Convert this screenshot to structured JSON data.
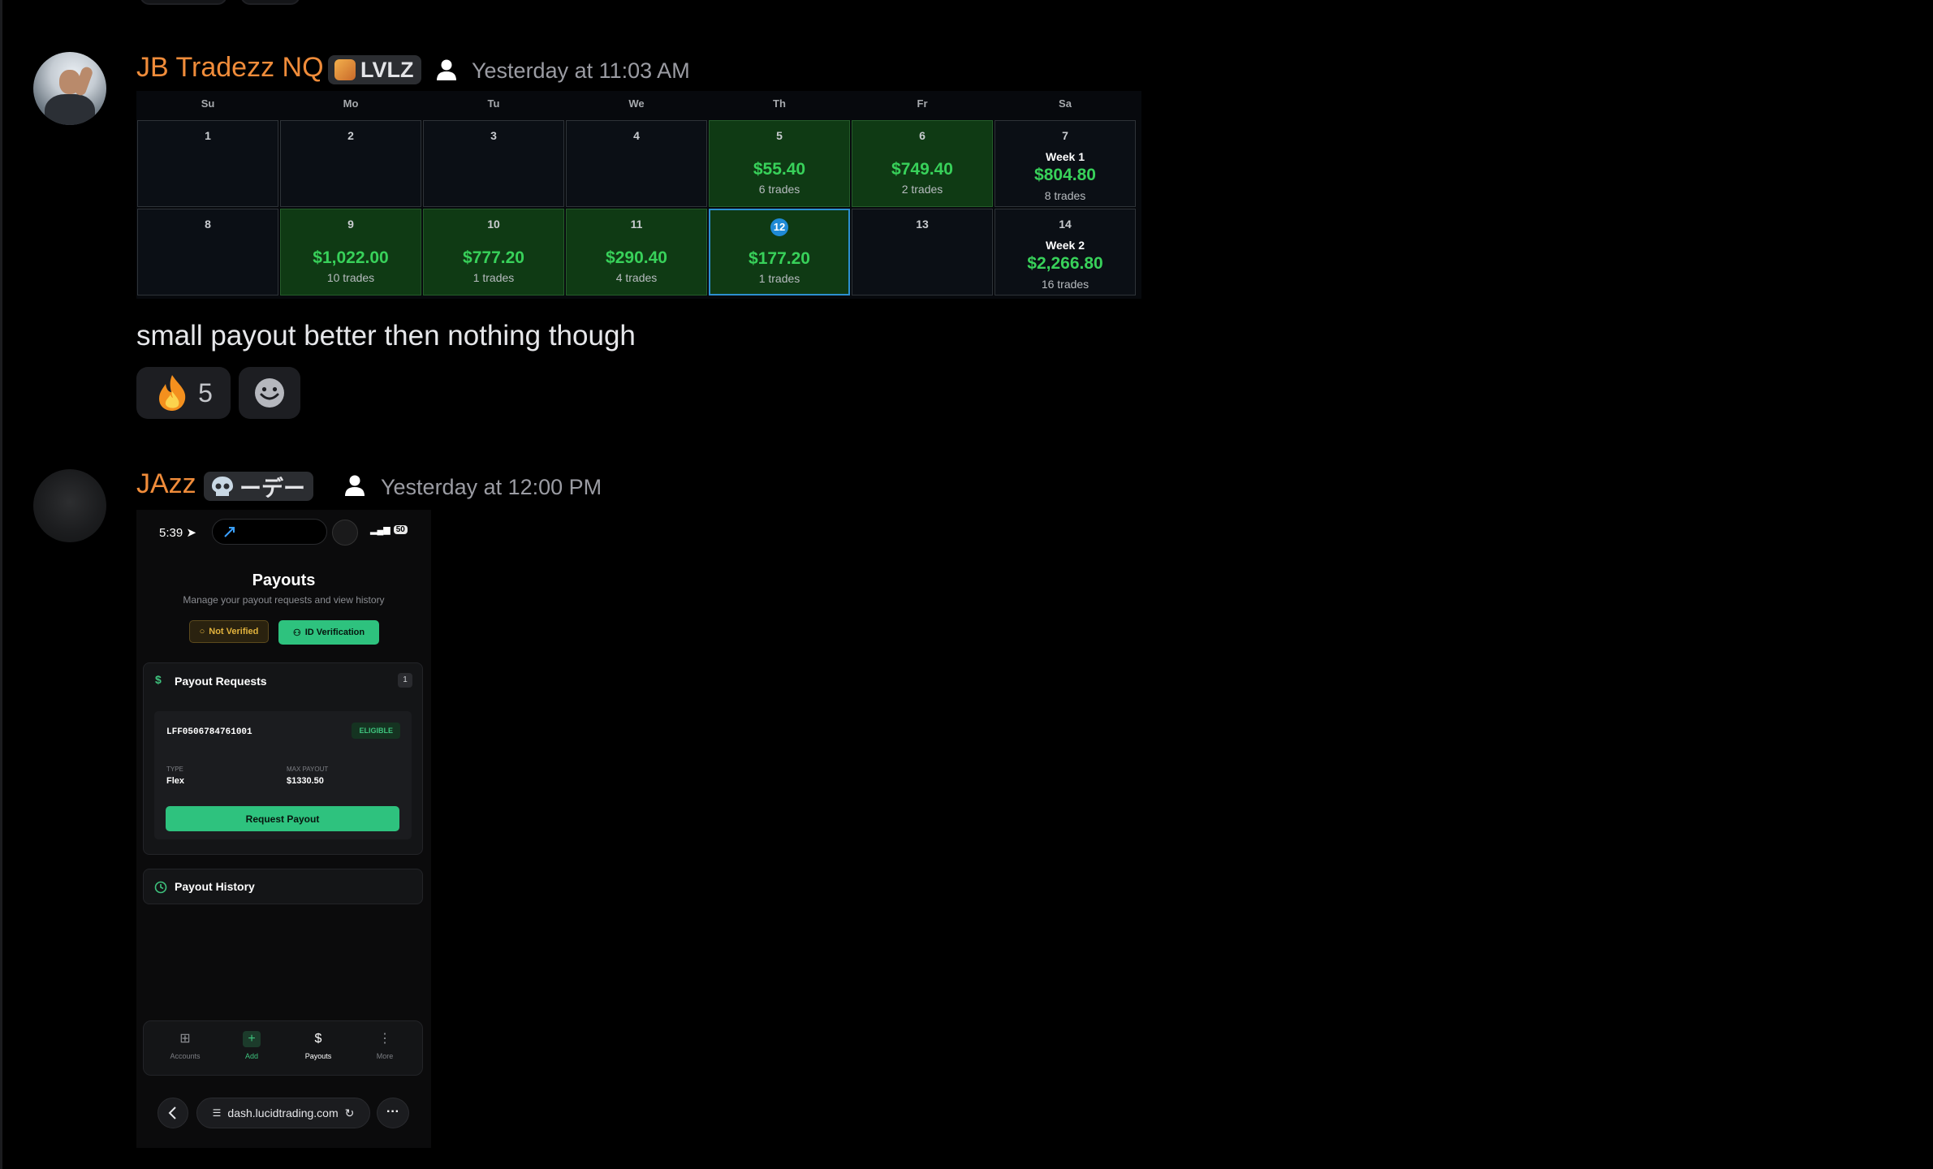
{
  "message1": {
    "username": "JB Tradezz NQ",
    "role_badge": "LVLZ",
    "timestamp": "Yesterday at 11:03 AM",
    "text": "small payout better then nothing though",
    "reactions": [
      {
        "emoji": "🔥",
        "count": "5"
      }
    ],
    "calendar": {
      "weekdays": [
        "Su",
        "Mo",
        "Tu",
        "We",
        "Th",
        "Fr",
        "Sa"
      ],
      "week1": [
        {
          "day": "1",
          "amount": "",
          "trades": ""
        },
        {
          "day": "2",
          "amount": "",
          "trades": ""
        },
        {
          "day": "3",
          "amount": "",
          "trades": ""
        },
        {
          "day": "4",
          "amount": "",
          "trades": ""
        },
        {
          "day": "5",
          "amount": "$55.40",
          "trades": "6 trades"
        },
        {
          "day": "6",
          "amount": "$749.40",
          "trades": "2 trades"
        },
        {
          "day": "7",
          "week_label": "Week 1",
          "amount": "$804.80",
          "trades": "8 trades"
        }
      ],
      "week2": [
        {
          "day": "8",
          "amount": "",
          "trades": ""
        },
        {
          "day": "9",
          "amount": "$1,022.00",
          "trades": "10 trades"
        },
        {
          "day": "10",
          "amount": "$777.20",
          "trades": "1 trades"
        },
        {
          "day": "11",
          "amount": "$290.40",
          "trades": "4 trades"
        },
        {
          "day": "12",
          "amount": "$177.20",
          "trades": "1 trades"
        },
        {
          "day": "13",
          "amount": "",
          "trades": ""
        },
        {
          "day": "14",
          "week_label": "Week 2",
          "amount": "$2,266.80",
          "trades": "16 trades"
        }
      ]
    }
  },
  "message2": {
    "username": "JAzz",
    "role_badge": "ーデー",
    "timestamp": "Yesterday at 12:00 PM",
    "phone": {
      "time": "5:39",
      "battery": "50",
      "title": "Payouts",
      "subtitle": "Manage your payout requests and view history",
      "not_verified": "Not Verified",
      "id_verification": "ID Verification",
      "payout_requests_title": "Payout Requests",
      "payout_requests_count": "1",
      "account_id": "LFF0506784761001",
      "status": "ELIGIBLE",
      "type_label": "TYPE",
      "type_value": "Flex",
      "max_label": "MAX PAYOUT",
      "max_value": "$1330.50",
      "request_button": "Request Payout",
      "history_title": "Payout History",
      "tabs": [
        "Accounts",
        "Add",
        "Payouts",
        "More"
      ],
      "url": "dash.lucidtrading.com"
    }
  },
  "colors": {
    "username": "#f08c3a",
    "profit_green": "#38d15a",
    "accent_green": "#2ec27e",
    "selected_day": "#1f8ad6"
  }
}
